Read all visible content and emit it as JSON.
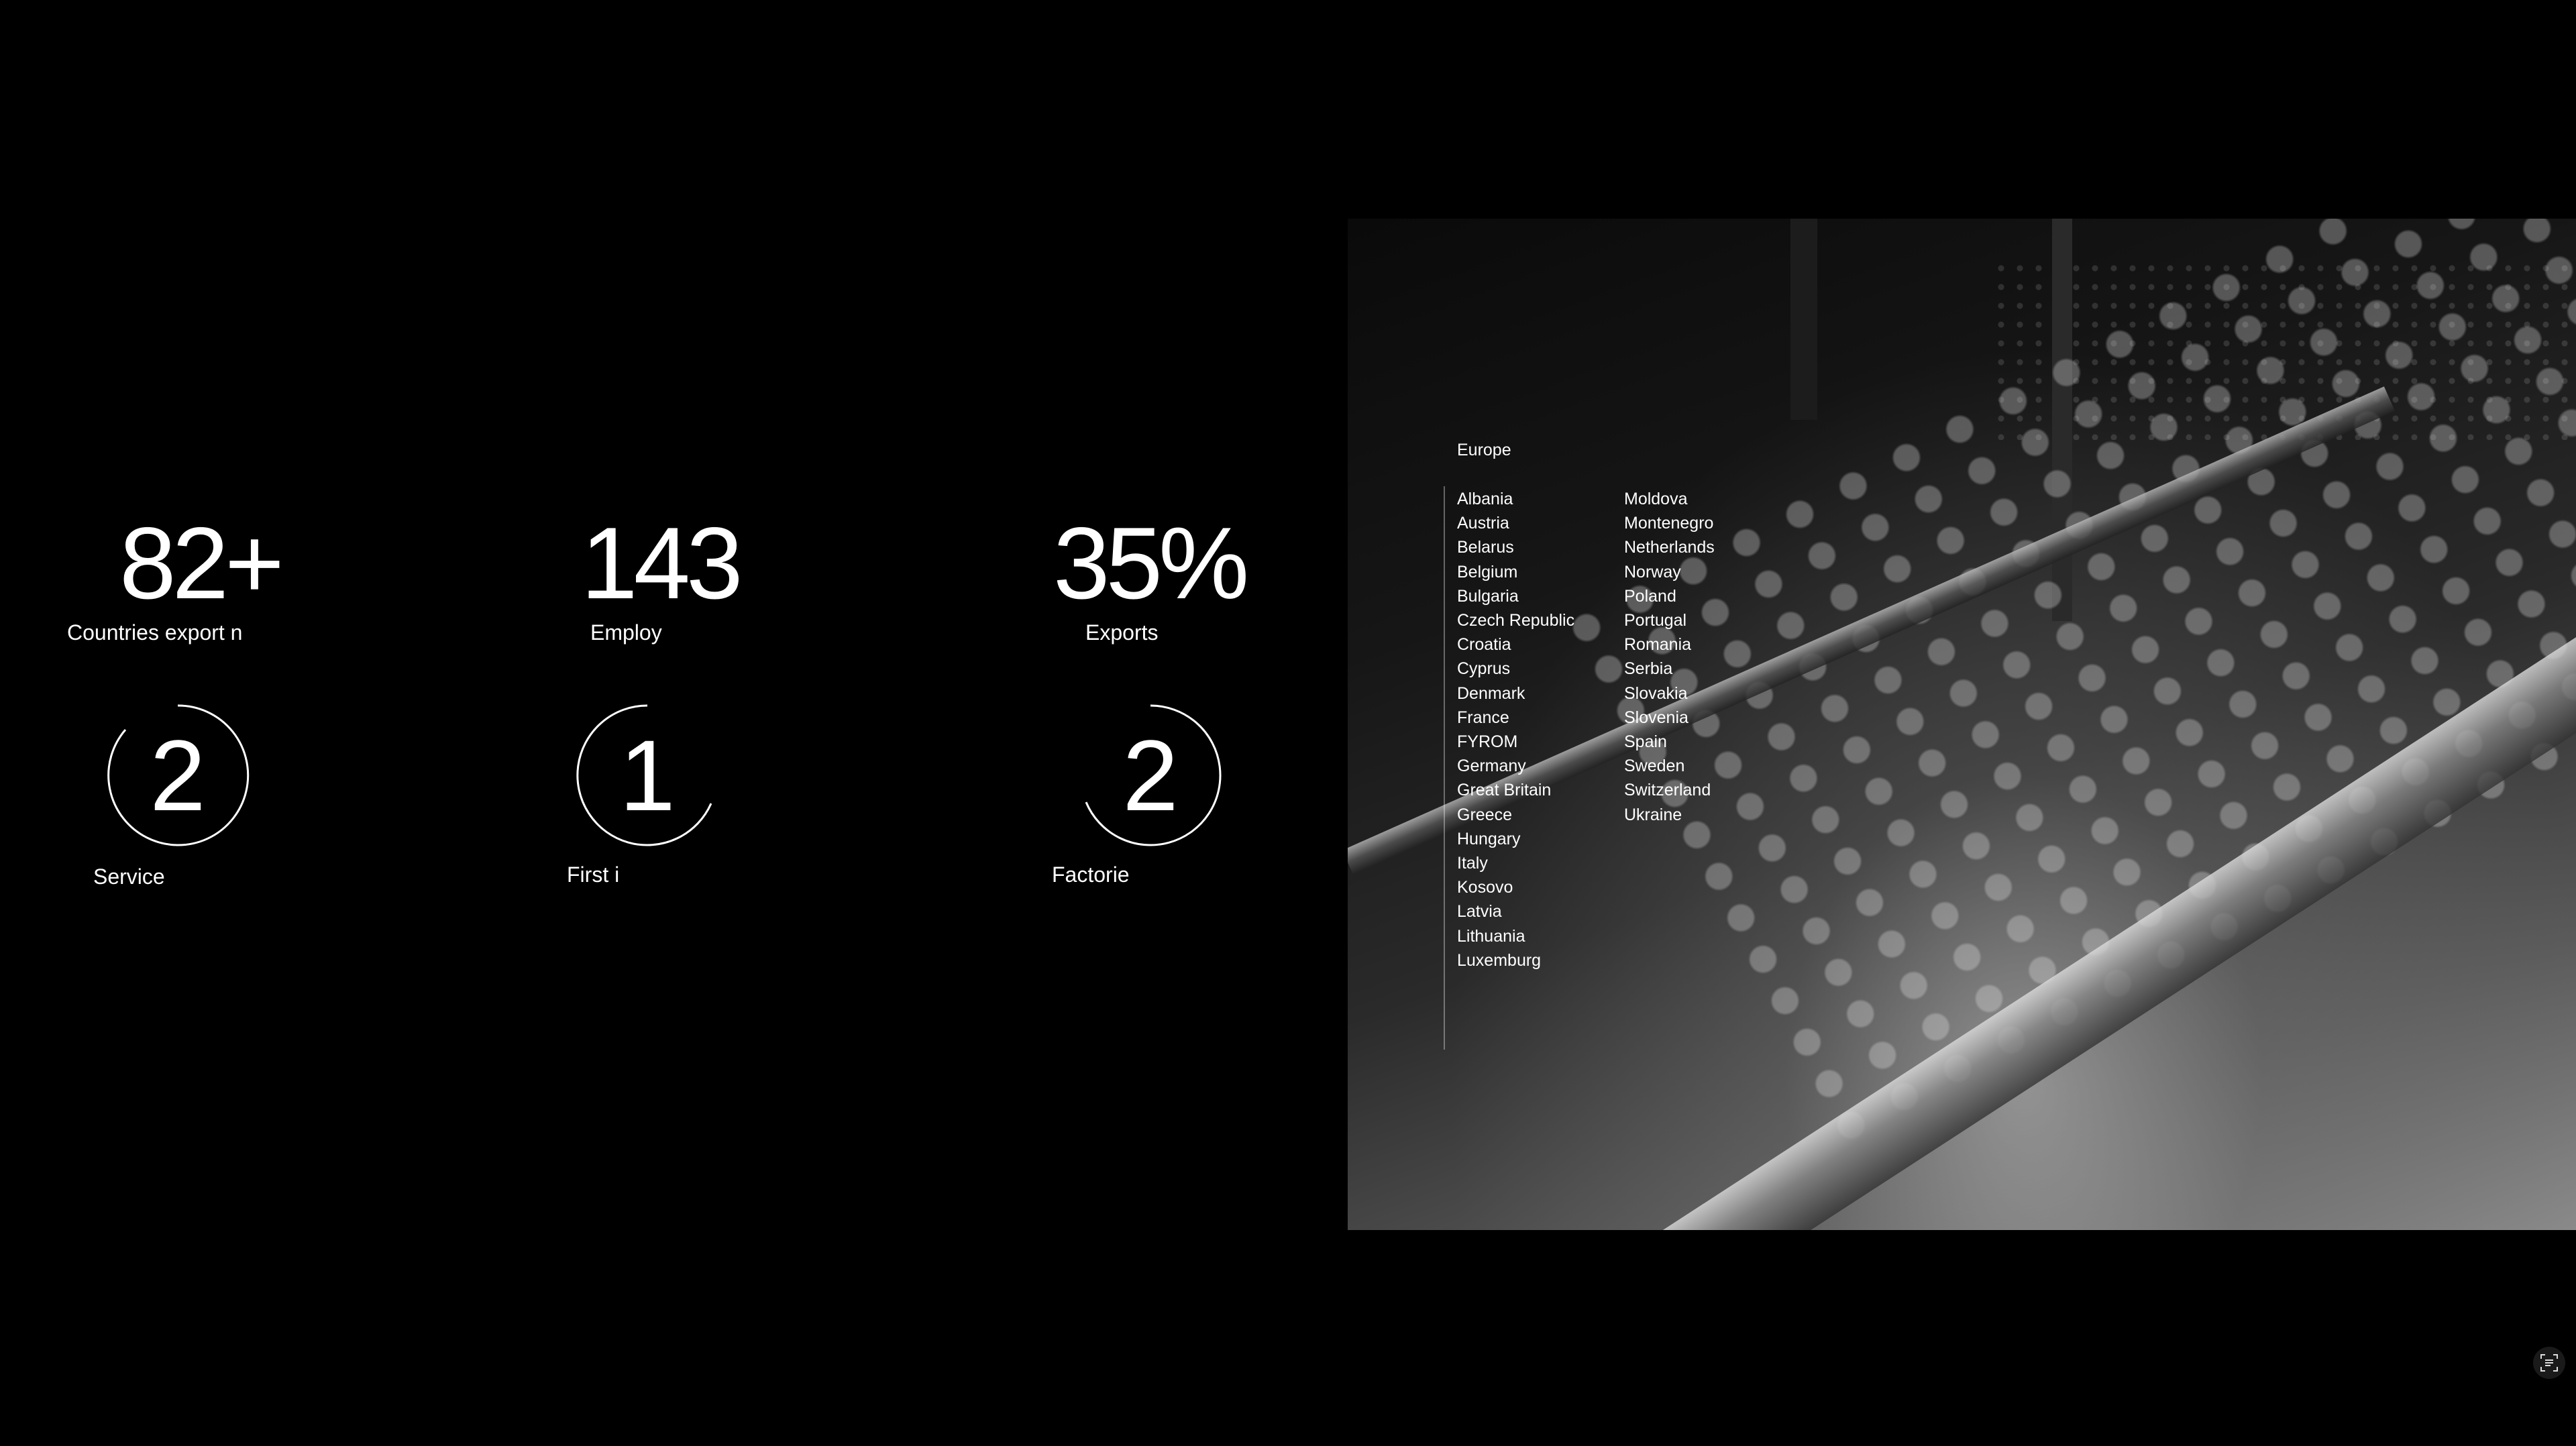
{
  "stats": [
    {
      "value": "82+",
      "label": "Countries export n"
    },
    {
      "value": "143",
      "label": "Employ"
    },
    {
      "value": "35%",
      "label": "Exports"
    }
  ],
  "circle_stats": [
    {
      "value": "2",
      "label": "Service"
    },
    {
      "value": "1",
      "label": "First i"
    },
    {
      "value": "2",
      "label": "Factorie"
    }
  ],
  "region": {
    "title": "Europe",
    "column_a": [
      "Albania",
      "Austria",
      "Belarus",
      "Belgium",
      "Bulgaria",
      "Czech Republic",
      "Croatia",
      "Cyprus",
      "Denmark",
      "France",
      "FYROM",
      "Germany",
      "Great Britain",
      "Greece",
      "Hungary",
      "Italy",
      "Kosovo",
      "Latvia",
      "Lithuania",
      "Luxemburg"
    ],
    "column_b": [
      "Moldova",
      "Montenegro",
      "Netherlands",
      "Norway",
      "Poland",
      "Portugal",
      "Romania",
      "Serbia",
      "Slovakia",
      "Slovenia",
      "Spain",
      "Sweden",
      "Switzerland",
      "Ukraine"
    ]
  },
  "icons": {
    "corner": "scan-text-icon"
  }
}
